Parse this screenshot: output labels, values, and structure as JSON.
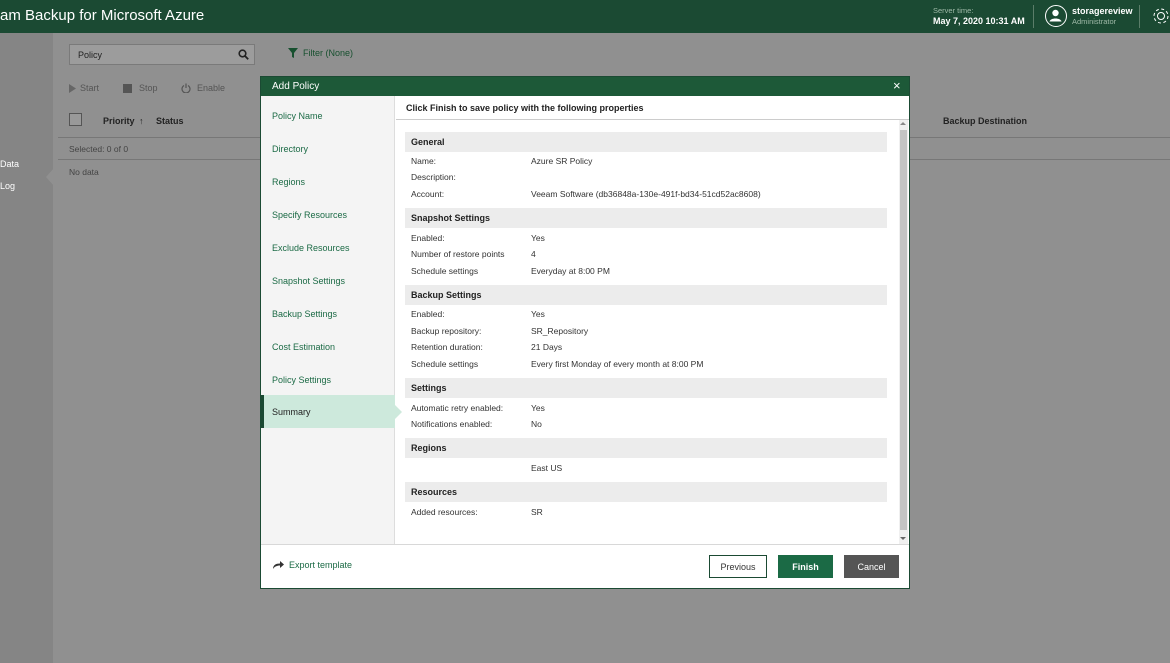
{
  "app": {
    "title": "am Backup for Microsoft Azure"
  },
  "header": {
    "server_time_label": "Server time:",
    "server_time": "May 7, 2020 10:31 AM",
    "username": "storagereview",
    "role": "Administrator"
  },
  "leftnav": {
    "items": [
      "Data",
      "Log"
    ]
  },
  "page": {
    "search_value": "Policy",
    "filter_label": "Filter (None)",
    "toolbar": [
      "Start",
      "Stop",
      "Enable"
    ],
    "columns": {
      "priority": "Priority",
      "status": "Status",
      "backup_destination": "Backup Destination"
    },
    "selected": "Selected:  0 of 0",
    "no_data": "No data"
  },
  "modal": {
    "title": "Add Policy",
    "close": "×",
    "steps": [
      "Policy Name",
      "Directory",
      "Regions",
      "Specify Resources",
      "Exclude Resources",
      "Snapshot Settings",
      "Backup Settings",
      "Cost Estimation",
      "Policy Settings",
      "Summary"
    ],
    "active_step": "Summary",
    "heading": "Click Finish to save policy with the following properties",
    "sections": {
      "general": {
        "title": "General",
        "name_key": "Name:",
        "name_val": "Azure SR Policy",
        "desc_key": "Description:",
        "account_key": "Account:",
        "account_val": "Veeam Software (db36848a-130e-491f-bd34-51cd52ac8608)"
      },
      "snapshot": {
        "title": "Snapshot Settings",
        "enabled_key": "Enabled:",
        "enabled_val": "Yes",
        "points_key": "Number of restore points",
        "points_val": "4",
        "schedule_key": "Schedule settings",
        "schedule_val": "Everyday at 8:00 PM"
      },
      "backup": {
        "title": "Backup Settings",
        "enabled_key": "Enabled:",
        "enabled_val": "Yes",
        "repo_key": "Backup repository:",
        "repo_val": "SR_Repository",
        "retention_key": "Retention duration:",
        "retention_val": "21 Days",
        "schedule_key": "Schedule settings",
        "schedule_val": "Every first Monday of every month at 8:00 PM"
      },
      "settings": {
        "title": "Settings",
        "retry_key": "Automatic retry enabled:",
        "retry_val": "Yes",
        "notif_key": "Notifications enabled:",
        "notif_val": "No"
      },
      "regions": {
        "title": "Regions",
        "value": "East US"
      },
      "resources": {
        "title": "Resources",
        "added_key": "Added resources:",
        "added_val": "SR"
      }
    },
    "export_template": "Export template",
    "buttons": {
      "previous": "Previous",
      "finish": "Finish",
      "cancel": "Cancel"
    }
  },
  "colors": {
    "brand": "#1b4a33",
    "accent": "#1b6a45",
    "active_step": "#cde9dc"
  },
  "icons": [
    "search-icon",
    "filter-icon",
    "play-icon",
    "stop-icon",
    "power-icon",
    "user-icon",
    "gear-icon",
    "close-icon",
    "export-icon",
    "sort-arrow-icon"
  ]
}
